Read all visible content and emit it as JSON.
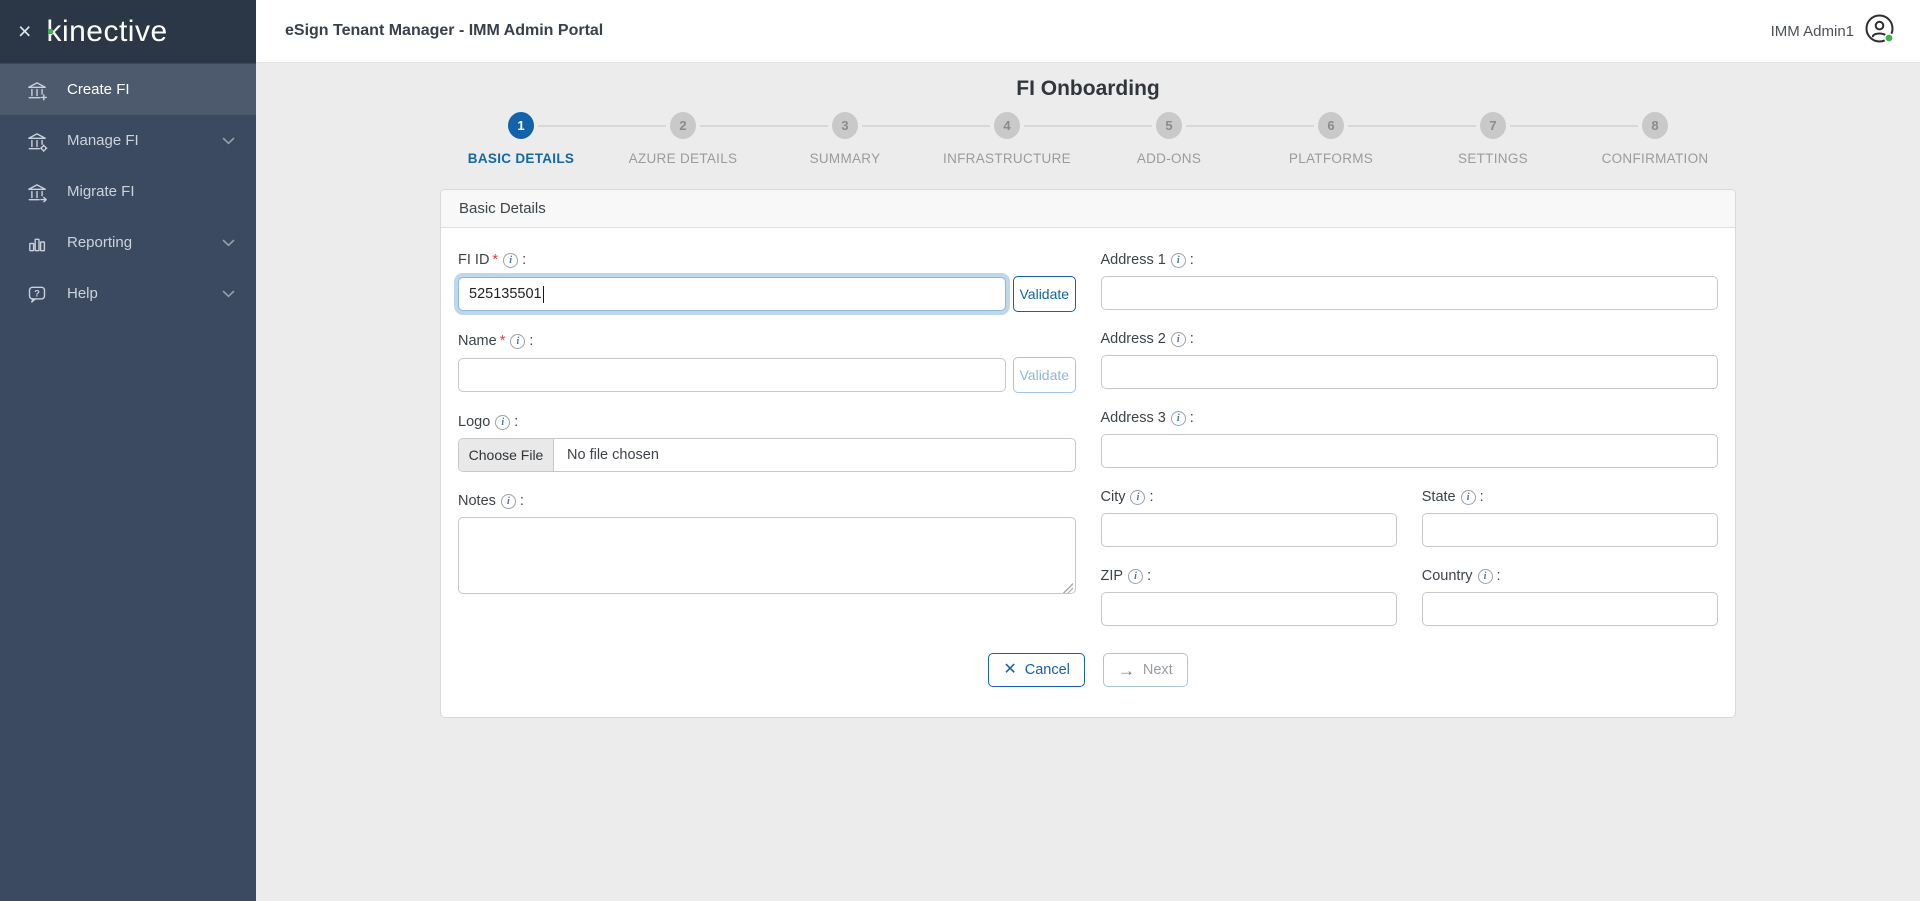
{
  "colors": {
    "accent_blue": "#1263a8",
    "status_green": "#3cb54b",
    "sidebar_bg": "#3b4961",
    "sidebar_logo_bg": "#2b3747",
    "sidebar_active_bg": "#4d5a6e",
    "content_bg": "#ececed",
    "step_inactive_grey": "#c9c9c9",
    "required_red": "#e23b3b"
  },
  "icons": {
    "close_glyph": "×",
    "cancel_glyph": "✕",
    "next_glyph": "→",
    "info_glyph": "i"
  },
  "sidebar": {
    "logo_text": "kinective",
    "items": [
      {
        "label": "Create FI"
      },
      {
        "label": "Manage FI"
      },
      {
        "label": "Migrate FI"
      },
      {
        "label": "Reporting"
      },
      {
        "label": "Help"
      }
    ]
  },
  "header": {
    "title": "eSign Tenant Manager - IMM Admin Portal",
    "user_name": "IMM Admin1"
  },
  "wizard": {
    "title": "FI Onboarding",
    "steps": [
      {
        "number": "1",
        "label": "BASIC DETAILS"
      },
      {
        "number": "2",
        "label": "AZURE DETAILS"
      },
      {
        "number": "3",
        "label": "SUMMARY"
      },
      {
        "number": "4",
        "label": "INFRASTRUCTURE"
      },
      {
        "number": "5",
        "label": "ADD-ONS"
      },
      {
        "number": "6",
        "label": "PLATFORMS"
      },
      {
        "number": "7",
        "label": "SETTINGS"
      },
      {
        "number": "8",
        "label": "CONFIRMATION"
      }
    ]
  },
  "form": {
    "section_title": "Basic Details",
    "required_marker": "*",
    "colon": ":",
    "validate_label": "Validate",
    "fields": {
      "fi_id": {
        "label": "FI ID",
        "value": "525135501"
      },
      "name": {
        "label": "Name",
        "value": ""
      },
      "logo": {
        "label": "Logo",
        "choose_file_label": "Choose File",
        "status_text": "No file chosen"
      },
      "notes": {
        "label": "Notes",
        "value": ""
      },
      "address1": {
        "label": "Address 1",
        "value": ""
      },
      "address2": {
        "label": "Address 2",
        "value": ""
      },
      "address3": {
        "label": "Address 3",
        "value": ""
      },
      "city": {
        "label": "City",
        "value": ""
      },
      "state": {
        "label": "State",
        "value": ""
      },
      "zip": {
        "label": "ZIP",
        "value": ""
      },
      "country": {
        "label": "Country",
        "value": ""
      }
    },
    "buttons": {
      "cancel": "Cancel",
      "next": "Next"
    }
  }
}
